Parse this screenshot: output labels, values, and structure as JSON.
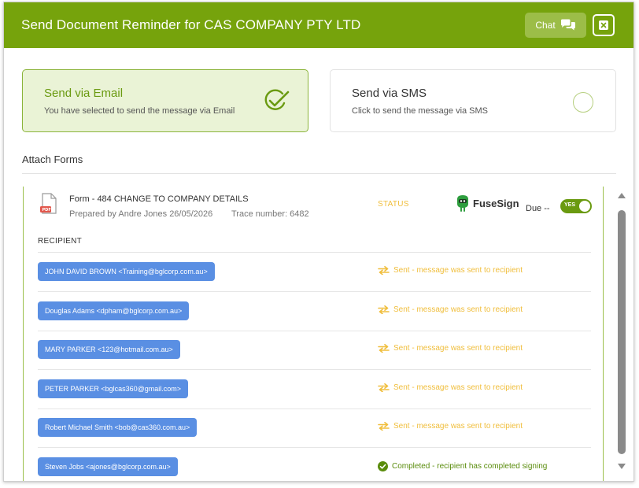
{
  "header": {
    "title": "Send Document Reminder for CAS COMPANY PTY LTD",
    "chat_label": "Chat",
    "accent_color": "#76a30c"
  },
  "send_options": {
    "email": {
      "title": "Send via Email",
      "description": "You have selected to send the message via Email",
      "selected": true
    },
    "sms": {
      "title": "Send via SMS",
      "description": "Click to send the message via SMS",
      "selected": false
    }
  },
  "attach_forms": {
    "label": "Attach Forms",
    "form": {
      "title": "Form - 484 CHANGE TO COMPANY DETAILS",
      "prepared_by": "Prepared by Andre Jones 26/05/2026",
      "trace_number": "Trace number: 6482",
      "provider": "FuseSign",
      "due_label": "Due --",
      "toggle_label": "YES",
      "toggle_on": true,
      "columns": {
        "recipient": "RECIPIENT",
        "status": "STATUS"
      },
      "recipients": [
        {
          "name": "JOHN DAVID BROWN <Training@bglcorp.com.au>",
          "status": "Sent - message was sent to recipient",
          "state": "sent"
        },
        {
          "name": "Douglas Adams <dpham@bglcorp.com.au>",
          "status": "Sent - message was sent to recipient",
          "state": "sent"
        },
        {
          "name": "MARY PARKER <123@hotmail.com.au>",
          "status": "Sent - message was sent to recipient",
          "state": "sent"
        },
        {
          "name": "PETER PARKER <bglcas360@gmail.com>",
          "status": "Sent - message was sent to recipient",
          "state": "sent"
        },
        {
          "name": "Robert Michael Smith <bob@cas360.com.au>",
          "status": "Sent - message was sent to recipient",
          "state": "sent"
        },
        {
          "name": "Steven Jobs <ajones@bglcorp.com.au>",
          "status": "Completed - recipient has completed signing",
          "state": "completed"
        }
      ]
    }
  },
  "colors": {
    "sent": "#f0be3c",
    "completed": "#5a8c0c",
    "chip": "#5a8fe3"
  }
}
